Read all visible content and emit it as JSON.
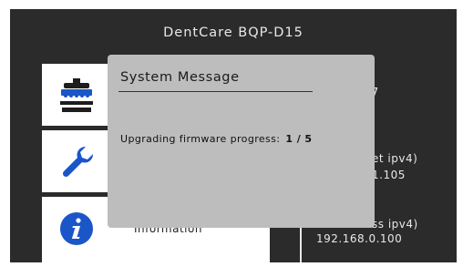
{
  "header": {
    "title": "DentCare BQP-D15"
  },
  "menu": {
    "items": [
      {
        "icon": "dental-chair-icon",
        "label": ""
      },
      {
        "icon": "wrench-icon",
        "label": ""
      },
      {
        "icon": "info-icon",
        "label": "Information"
      }
    ]
  },
  "info_panel": {
    "partial_top": "7",
    "wired_label": "et ipv4)",
    "wired_value": "1.105",
    "wireless_label": "ss ipv4)",
    "wireless_value": "192.168.0.100"
  },
  "dialog": {
    "title": "System Message",
    "message_label": "Upgrading firmware progress:",
    "progress_value": "1 / 5"
  },
  "colors": {
    "background": "#2b2b2b",
    "menu_bg": "#ffffff",
    "icon_blue": "#1a56c8",
    "icon_dark": "#1d1d1d",
    "dialog_bg": "#bdbdbd"
  }
}
